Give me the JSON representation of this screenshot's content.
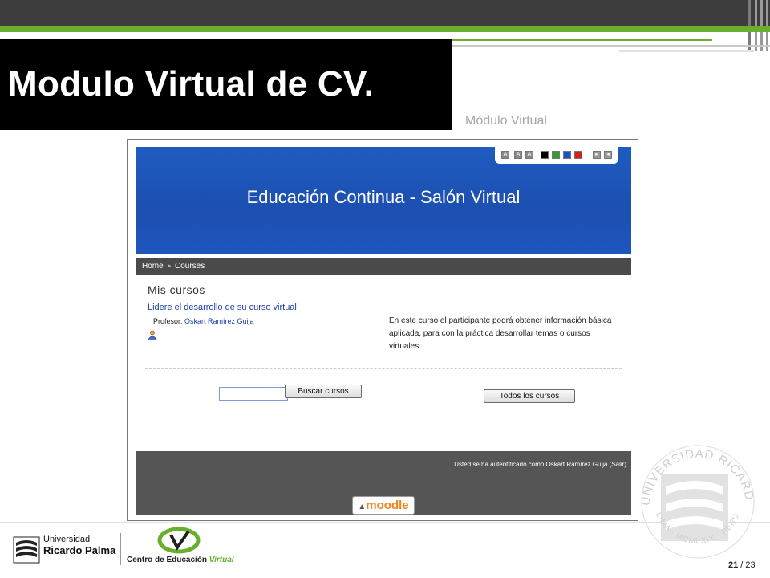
{
  "slide": {
    "title": "Modulo Virtual de CV.",
    "subtitle": "Módulo Virtual",
    "page_current": "21",
    "page_sep": " / ",
    "page_total": "23"
  },
  "colors": {
    "dark_bar": "#3c3c3c",
    "accent_green": "#6aae2f",
    "banner_blue": "#1f56bf",
    "nav_dark": "#4a4a4a",
    "link_blue": "#1a3fa8",
    "moodle_orange": "#f58220"
  },
  "screenshot": {
    "banner_title": "Educación Continua - Salón Virtual",
    "toolbar": {
      "text_size_buttons": [
        "A",
        "A",
        "A"
      ],
      "color_swatches": [
        "#000000",
        "#2ea02e",
        "#1f4fc0",
        "#cc2222"
      ]
    },
    "nav": {
      "home": "Home",
      "separator": "▸",
      "courses": "Courses"
    },
    "main": {
      "heading": "Mis cursos",
      "course_title": "Lidere el desarrollo de su curso virtual",
      "professor_label": "Profesor:",
      "professor_name": "Oskart Ramírez Guija",
      "description": "En este curso el participante podrá obtener información básica aplicada, para con la práctica desarrollar temas o cursos virtuales.",
      "search_value": "",
      "search_button": "Buscar cursos",
      "all_courses_button": "Todos los cursos"
    },
    "footer": {
      "auth_text": "Usted se ha autentificado como Oskart Ramírez Guija (Salir)",
      "moodle_logo": "moodle"
    }
  },
  "branding": {
    "university_line1": "Universidad",
    "university_line2": "Ricardo Palma",
    "center_prefix": "Centro de Educación",
    "center_suffix": "Virtual",
    "seal_text": "UNIVERSIDAD RICARDO PALMA",
    "seal_bottom": "LIMA · MCMLXIX · PERU"
  }
}
